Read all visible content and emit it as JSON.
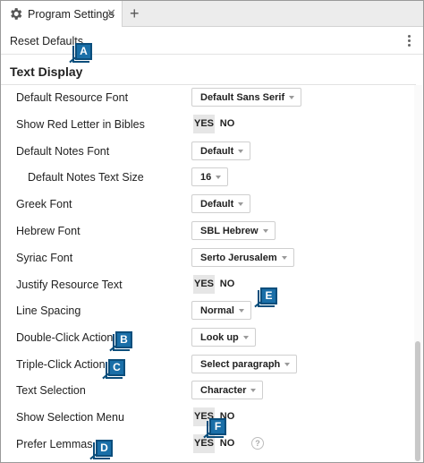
{
  "tab": {
    "title": "Program Settings",
    "close_glyph": "✕",
    "add_glyph": "+",
    "icon": "gear-icon"
  },
  "toolbar": {
    "reset_label": "Reset Defaults",
    "more_icon": "vertical-ellipsis-icon"
  },
  "section": {
    "title": "Text Display"
  },
  "rows": [
    {
      "label": "Default Resource Font",
      "type": "dropdown",
      "value": "Default Sans Serif"
    },
    {
      "label": "Show Red Letter in Bibles",
      "type": "toggle",
      "yes": "YES",
      "no": "NO",
      "selected": "YES"
    },
    {
      "label": "Default Notes Font",
      "type": "dropdown",
      "value": "Default"
    },
    {
      "label": "Default Notes Text Size",
      "type": "dropdown",
      "value": "16"
    },
    {
      "label": "Greek Font",
      "type": "dropdown",
      "value": "Default"
    },
    {
      "label": "Hebrew Font",
      "type": "dropdown",
      "value": "SBL Hebrew"
    },
    {
      "label": "Syriac Font",
      "type": "dropdown",
      "value": "Serto Jerusalem"
    },
    {
      "label": "Justify Resource Text",
      "type": "toggle",
      "yes": "YES",
      "no": "NO",
      "selected": "YES"
    },
    {
      "label": "Line Spacing",
      "type": "dropdown",
      "value": "Normal"
    },
    {
      "label": "Double-Click Action",
      "type": "dropdown",
      "value": "Look up"
    },
    {
      "label": "Triple-Click Action",
      "type": "dropdown",
      "value": "Select paragraph"
    },
    {
      "label": "Text Selection",
      "type": "dropdown",
      "value": "Character"
    },
    {
      "label": "Show Selection Menu",
      "type": "toggle",
      "yes": "YES",
      "no": "NO",
      "selected": "YES"
    },
    {
      "label": "Prefer Lemmas",
      "type": "toggle",
      "yes": "YES",
      "no": "NO",
      "selected": "YES",
      "help": "?"
    }
  ],
  "callouts": {
    "a": "A",
    "b": "B",
    "c": "C",
    "d": "D",
    "e": "E",
    "f": "F"
  },
  "colors": {
    "callout_fill": "#1a6fa8",
    "callout_border": "#0b4e7c",
    "selected_toggle_bg": "#e6e6e6"
  }
}
